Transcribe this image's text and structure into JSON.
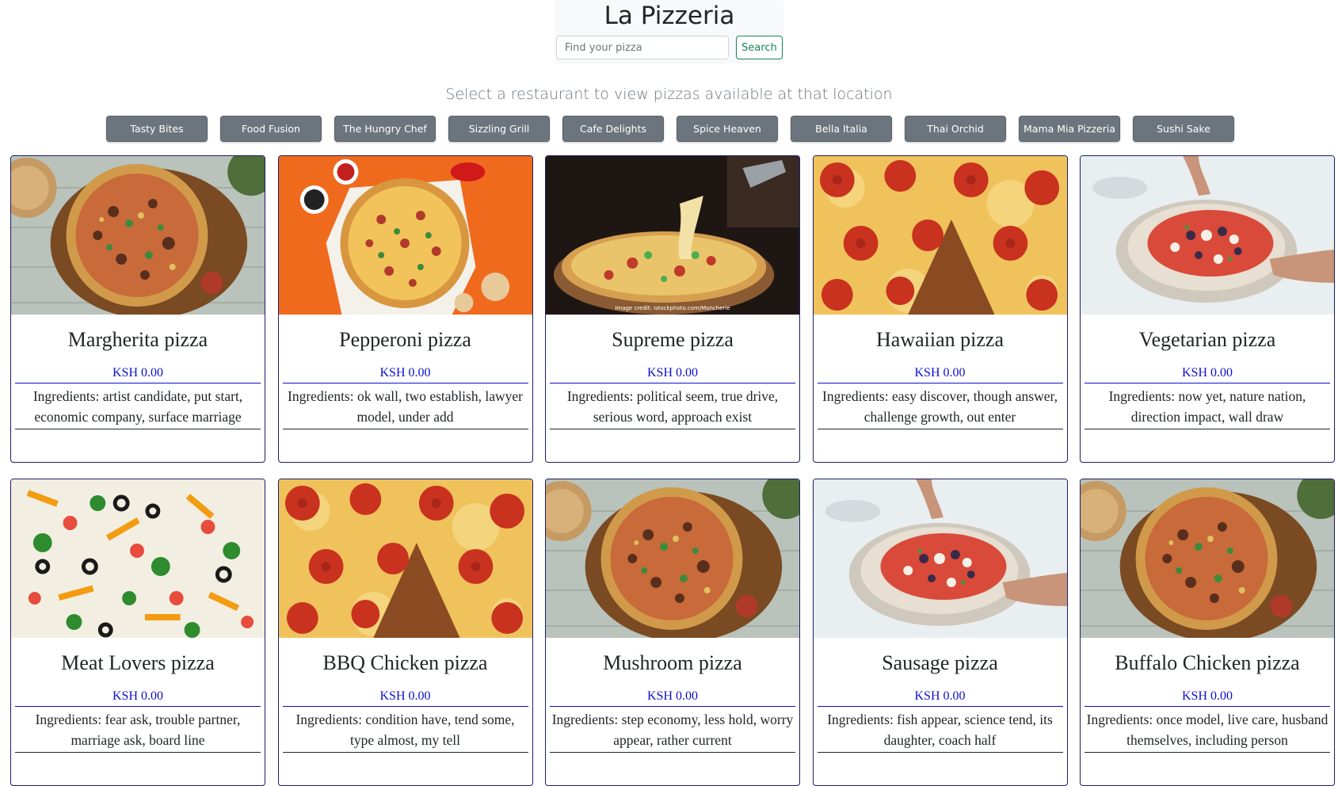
{
  "header": {
    "title": "La Pizzeria",
    "search_placeholder": "Find your pizza",
    "search_button": "Search"
  },
  "subtitle": "Select a restaurant to view pizzas available at that location",
  "restaurants": [
    "Tasty Bites",
    "Food Fusion",
    "The Hungry Chef",
    "Sizzling Grill",
    "Cafe Delights",
    "Spice Heaven",
    "Bella Italia",
    "Thai Orchid",
    "Mama Mia Pizzeria",
    "Sushi Sake"
  ],
  "pizzas": [
    {
      "name": "Margherita pizza",
      "price": "KSH 0.00",
      "ingredients": "Ingredients: artist candidate, put start, economic company, surface marriage",
      "image": "pizza-wood-board"
    },
    {
      "name": "Pepperoni pizza",
      "price": "KSH 0.00",
      "ingredients": "Ingredients: ok wall, two establish, lawyer model, under add",
      "image": "pizza-orange-background"
    },
    {
      "name": "Supreme pizza",
      "price": "KSH 0.00",
      "ingredients": "Ingredients: political seem, true drive, serious word, approach exist",
      "image": "pizza-cheese-pull",
      "credit": "Image credit: istockphoto.com/Moncherie"
    },
    {
      "name": "Hawaiian pizza",
      "price": "KSH 0.00",
      "ingredients": "Ingredients: easy discover, though answer, challenge growth, out enter",
      "image": "pepperoni-closeup"
    },
    {
      "name": "Vegetarian pizza",
      "price": "KSH 0.00",
      "ingredients": "Ingredients: now yet, nature nation, direction impact, wall draw",
      "image": "pizza-hands-topping"
    },
    {
      "name": "Meat Lovers pizza",
      "price": "KSH 0.00",
      "ingredients": "Ingredients: fear ask, trouble partner, marriage ask, board line",
      "image": "veggie-closeup"
    },
    {
      "name": "BBQ Chicken pizza",
      "price": "KSH 0.00",
      "ingredients": "Ingredients: condition have, tend some, type almost, my tell",
      "image": "pepperoni-closeup"
    },
    {
      "name": "Mushroom pizza",
      "price": "KSH 0.00",
      "ingredients": "Ingredients: step economy, less hold, worry appear, rather current",
      "image": "pizza-wood-board"
    },
    {
      "name": "Sausage pizza",
      "price": "KSH 0.00",
      "ingredients": "Ingredients: fish appear, science tend, its daughter, coach half",
      "image": "pizza-hands-topping"
    },
    {
      "name": "Buffalo Chicken pizza",
      "price": "KSH 0.00",
      "ingredients": "Ingredients: once model, live care, husband themselves, including person",
      "image": "pizza-wood-board"
    }
  ],
  "colors": {
    "price": "#0d0dcc",
    "card_border": "#1d1d66",
    "restaurant_button": "#6c757d",
    "search_button": "#198754"
  }
}
